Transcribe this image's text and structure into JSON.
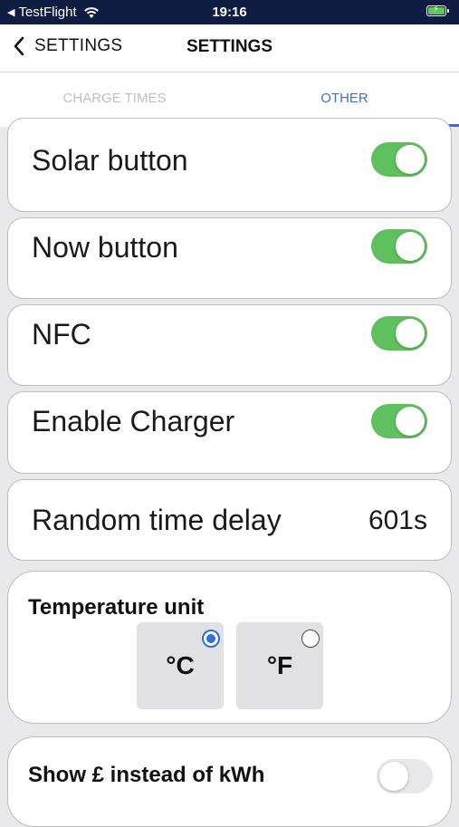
{
  "status_bar": {
    "carrier": "TestFlight",
    "time": "19:16",
    "icons": [
      "back-triangle-icon",
      "wifi-icon",
      "battery-charging-icon"
    ]
  },
  "nav": {
    "back_label": "SETTINGS",
    "title": "SETTINGS"
  },
  "tabs": {
    "items": [
      {
        "label": "CHARGE TIMES",
        "active": false
      },
      {
        "label": "OTHER",
        "active": true
      }
    ]
  },
  "settings": {
    "solar": {
      "label": "Solar button",
      "enabled": true
    },
    "now": {
      "label": "Now button",
      "enabled": true
    },
    "nfc": {
      "label": "NFC",
      "enabled": true
    },
    "charger": {
      "label": "Enable Charger",
      "enabled": true
    },
    "random_delay": {
      "label": "Random time delay",
      "value": "601s"
    },
    "temperature": {
      "title": "Temperature unit",
      "options": [
        {
          "label": "°C",
          "selected": true
        },
        {
          "label": "°F",
          "selected": false
        }
      ]
    },
    "show_currency": {
      "label": "Show £ instead of kWh",
      "enabled": false
    }
  },
  "colors": {
    "status_bar_bg": "#0f1d43",
    "toggle_on": "#5fc05f",
    "accent": "#2f6fe0",
    "page_bg": "#e9e9eb"
  }
}
